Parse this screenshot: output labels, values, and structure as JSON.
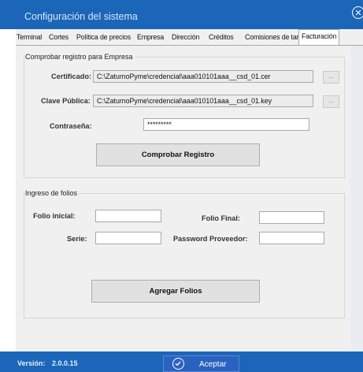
{
  "window": {
    "title": "Configuración del sistema"
  },
  "tabs": [
    {
      "label": "Terminal"
    },
    {
      "label": "Cortes"
    },
    {
      "label": "Política de precios"
    },
    {
      "label": "Empresa"
    },
    {
      "label": "Dirección"
    },
    {
      "label": "Créditos"
    },
    {
      "label": "Comisiones de tarjetas"
    },
    {
      "label": "Facturación",
      "active": true
    }
  ],
  "comprobar": {
    "group_title": "Comprobar registro para Empresa",
    "certificado_label": "Certificado:",
    "certificado_value": "C:\\ZaturnoPyme\\credencial\\aaa010101aaa__csd_01.cer",
    "clave_label": "Clave Pública:",
    "clave_value": "C:\\ZaturnoPyme\\credencial\\aaa010101aaa__csd_01.key",
    "browse_label": "...",
    "password_label": "Contraseña:",
    "password_value": "*********",
    "button_label": "Comprobar Registro"
  },
  "folios": {
    "group_title": "Ingreso de folios",
    "folio_inicial_label": "Folio inicial:",
    "folio_final_label": "Folio Final:",
    "serie_label": "Serie:",
    "password_proveedor_label": "Password Proveedor:",
    "button_label": "Agregar Folios"
  },
  "footer": {
    "version_label": "Versión:",
    "version_value": "2.0.0.15",
    "accept_label": "Aceptar"
  }
}
